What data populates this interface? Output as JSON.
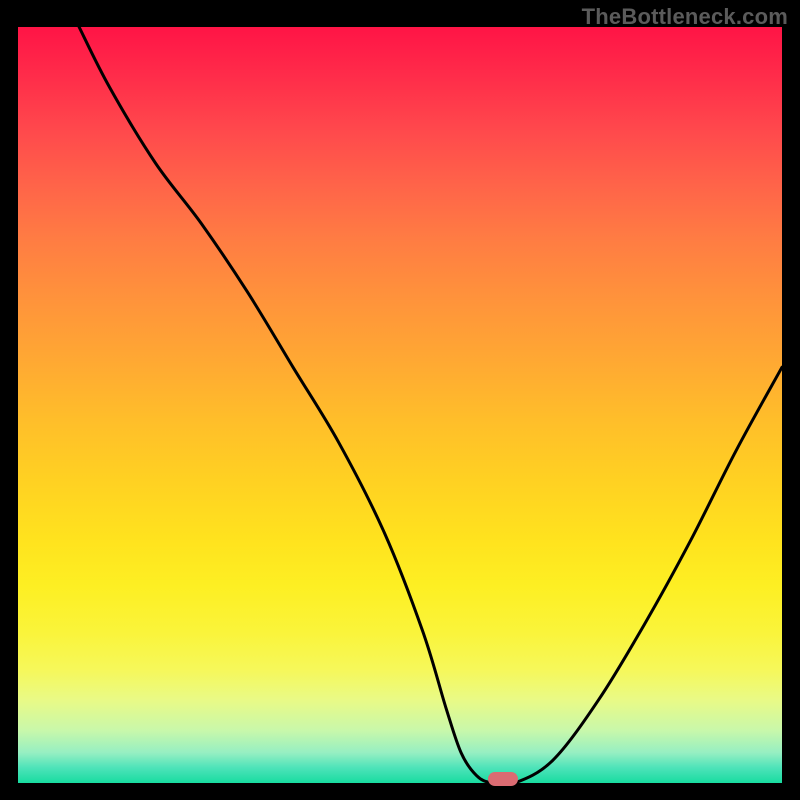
{
  "watermark": "TheBottleneck.com",
  "colors": {
    "curve_stroke": "#000000",
    "marker_fill": "#db6b72",
    "frame_bg": "#000000"
  },
  "chart_data": {
    "type": "line",
    "title": "",
    "xlabel": "",
    "ylabel": "",
    "xlim": [
      0,
      100
    ],
    "ylim": [
      0,
      100
    ],
    "grid": false,
    "legend": false,
    "series": [
      {
        "name": "bottleneck-curve",
        "x": [
          8,
          12,
          18,
          24,
          30,
          36,
          42,
          48,
          53,
          56,
          58,
          60,
          62,
          65,
          70,
          76,
          82,
          88,
          94,
          100
        ],
        "y": [
          100,
          92,
          82,
          74,
          65,
          55,
          45,
          33,
          20,
          10,
          4,
          1,
          0,
          0,
          3,
          11,
          21,
          32,
          44,
          55
        ]
      }
    ],
    "marker": {
      "x": 63.5,
      "y": 0.5
    }
  }
}
